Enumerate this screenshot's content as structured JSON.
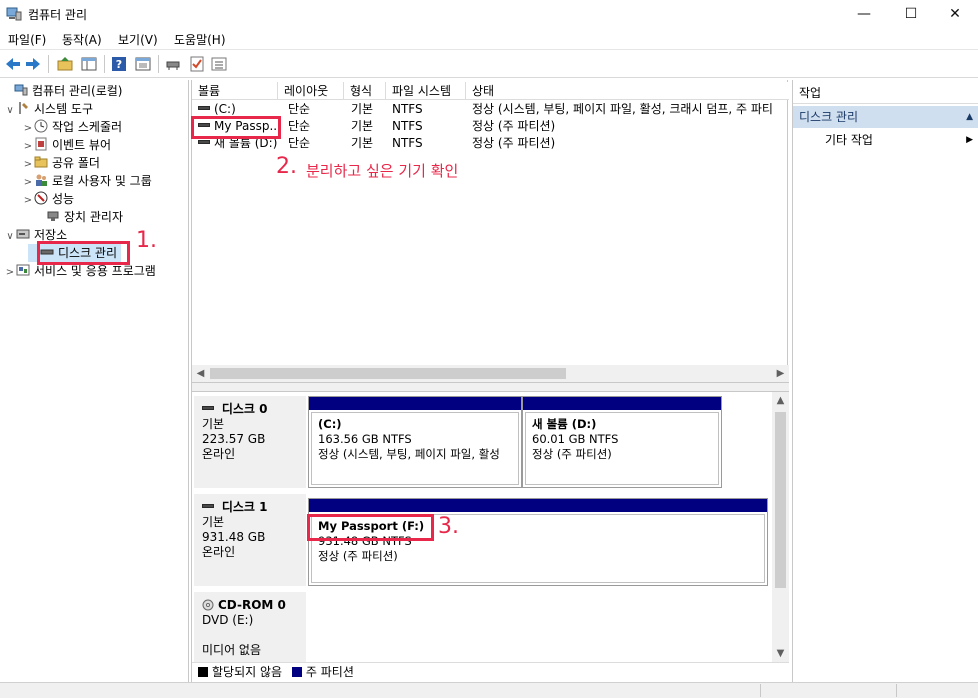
{
  "window": {
    "title": "컴퓨터 관리",
    "minimize_glyph": "—",
    "maximize_glyph": "☐",
    "close_glyph": "✕"
  },
  "menu": [
    "파일(F)",
    "동작(A)",
    "보기(V)",
    "도움말(H)"
  ],
  "toolbar_icons": [
    "back-arrow-icon",
    "forward-arrow-icon",
    "folder-up-icon",
    "show-hide-tree-icon",
    "help-icon",
    "properties-icon",
    "connect-icon",
    "check-icon",
    "list-icon"
  ],
  "tree": [
    {
      "label": "컴퓨터 관리(로컬)",
      "icon": "computer-management-icon",
      "expander": ""
    },
    {
      "label": "시스템 도구",
      "icon": "tools-icon",
      "expander": "∨"
    },
    {
      "label": "작업 스케줄러",
      "icon": "clock-icon",
      "expander": ">"
    },
    {
      "label": "이벤트 뷰어",
      "icon": "event-viewer-icon",
      "expander": ">"
    },
    {
      "label": "공유 폴더",
      "icon": "shared-folder-icon",
      "expander": ">"
    },
    {
      "label": "로컬 사용자 및 그룹",
      "icon": "users-icon",
      "expander": ">"
    },
    {
      "label": "성능",
      "icon": "performance-icon",
      "expander": ">"
    },
    {
      "label": "장치 관리자",
      "icon": "device-manager-icon",
      "expander": ""
    },
    {
      "label": "저장소",
      "icon": "storage-icon",
      "expander": "∨"
    },
    {
      "label": "디스크 관리",
      "icon": "disk-management-icon",
      "expander": ""
    },
    {
      "label": "서비스 및 응용 프로그램",
      "icon": "services-icon",
      "expander": ">"
    }
  ],
  "volume_table": {
    "columns": [
      "볼륨",
      "레이아웃",
      "형식",
      "파일 시스템",
      "상태"
    ],
    "rows": [
      {
        "volume": "(C:)",
        "layout": "단순",
        "type": "기본",
        "fs": "NTFS",
        "status": "정상 (시스템, 부팅, 페이지 파일, 활성, 크래시 덤프, 주 파티"
      },
      {
        "volume": "My Passp...",
        "layout": "단순",
        "type": "기본",
        "fs": "NTFS",
        "status": "정상 (주 파티션)"
      },
      {
        "volume": "새 볼륨 (D:)",
        "layout": "단순",
        "type": "기본",
        "fs": "NTFS",
        "status": "정상 (주 파티션)"
      }
    ]
  },
  "disks": [
    {
      "name": "디스크 0",
      "type": "기본",
      "size": "223.57 GB",
      "state": "온라인",
      "partitions": [
        {
          "name": "(C:)",
          "size": "163.56 GB NTFS",
          "status": "정상 (시스템, 부팅, 페이지 파일, 활성"
        },
        {
          "name": "새 볼륨  (D:)",
          "size": "60.01 GB NTFS",
          "status": "정상 (주 파티션)"
        }
      ]
    },
    {
      "name": "디스크 1",
      "type": "기본",
      "size": "931.48 GB",
      "state": "온라인",
      "partitions": [
        {
          "name": "My Passport  (F:)",
          "size": "931.48 GB NTFS",
          "status": "정상 (주 파티션)"
        }
      ]
    },
    {
      "name": "CD-ROM 0",
      "type": "DVD (E:)",
      "size": "",
      "state": "미디어 없음",
      "partitions": []
    }
  ],
  "legend": [
    {
      "label": "할당되지 않음",
      "color": "#000000"
    },
    {
      "label": "주 파티션",
      "color": "#000080"
    }
  ],
  "actions": {
    "header": "작업",
    "section": "디스크 관리",
    "item": "기타 작업"
  },
  "annotations": {
    "step1": "1.",
    "step2": "2.",
    "step2_text": "분리하고 싶은 기기 확인",
    "step3": "3.",
    "color": "#e8284a"
  }
}
